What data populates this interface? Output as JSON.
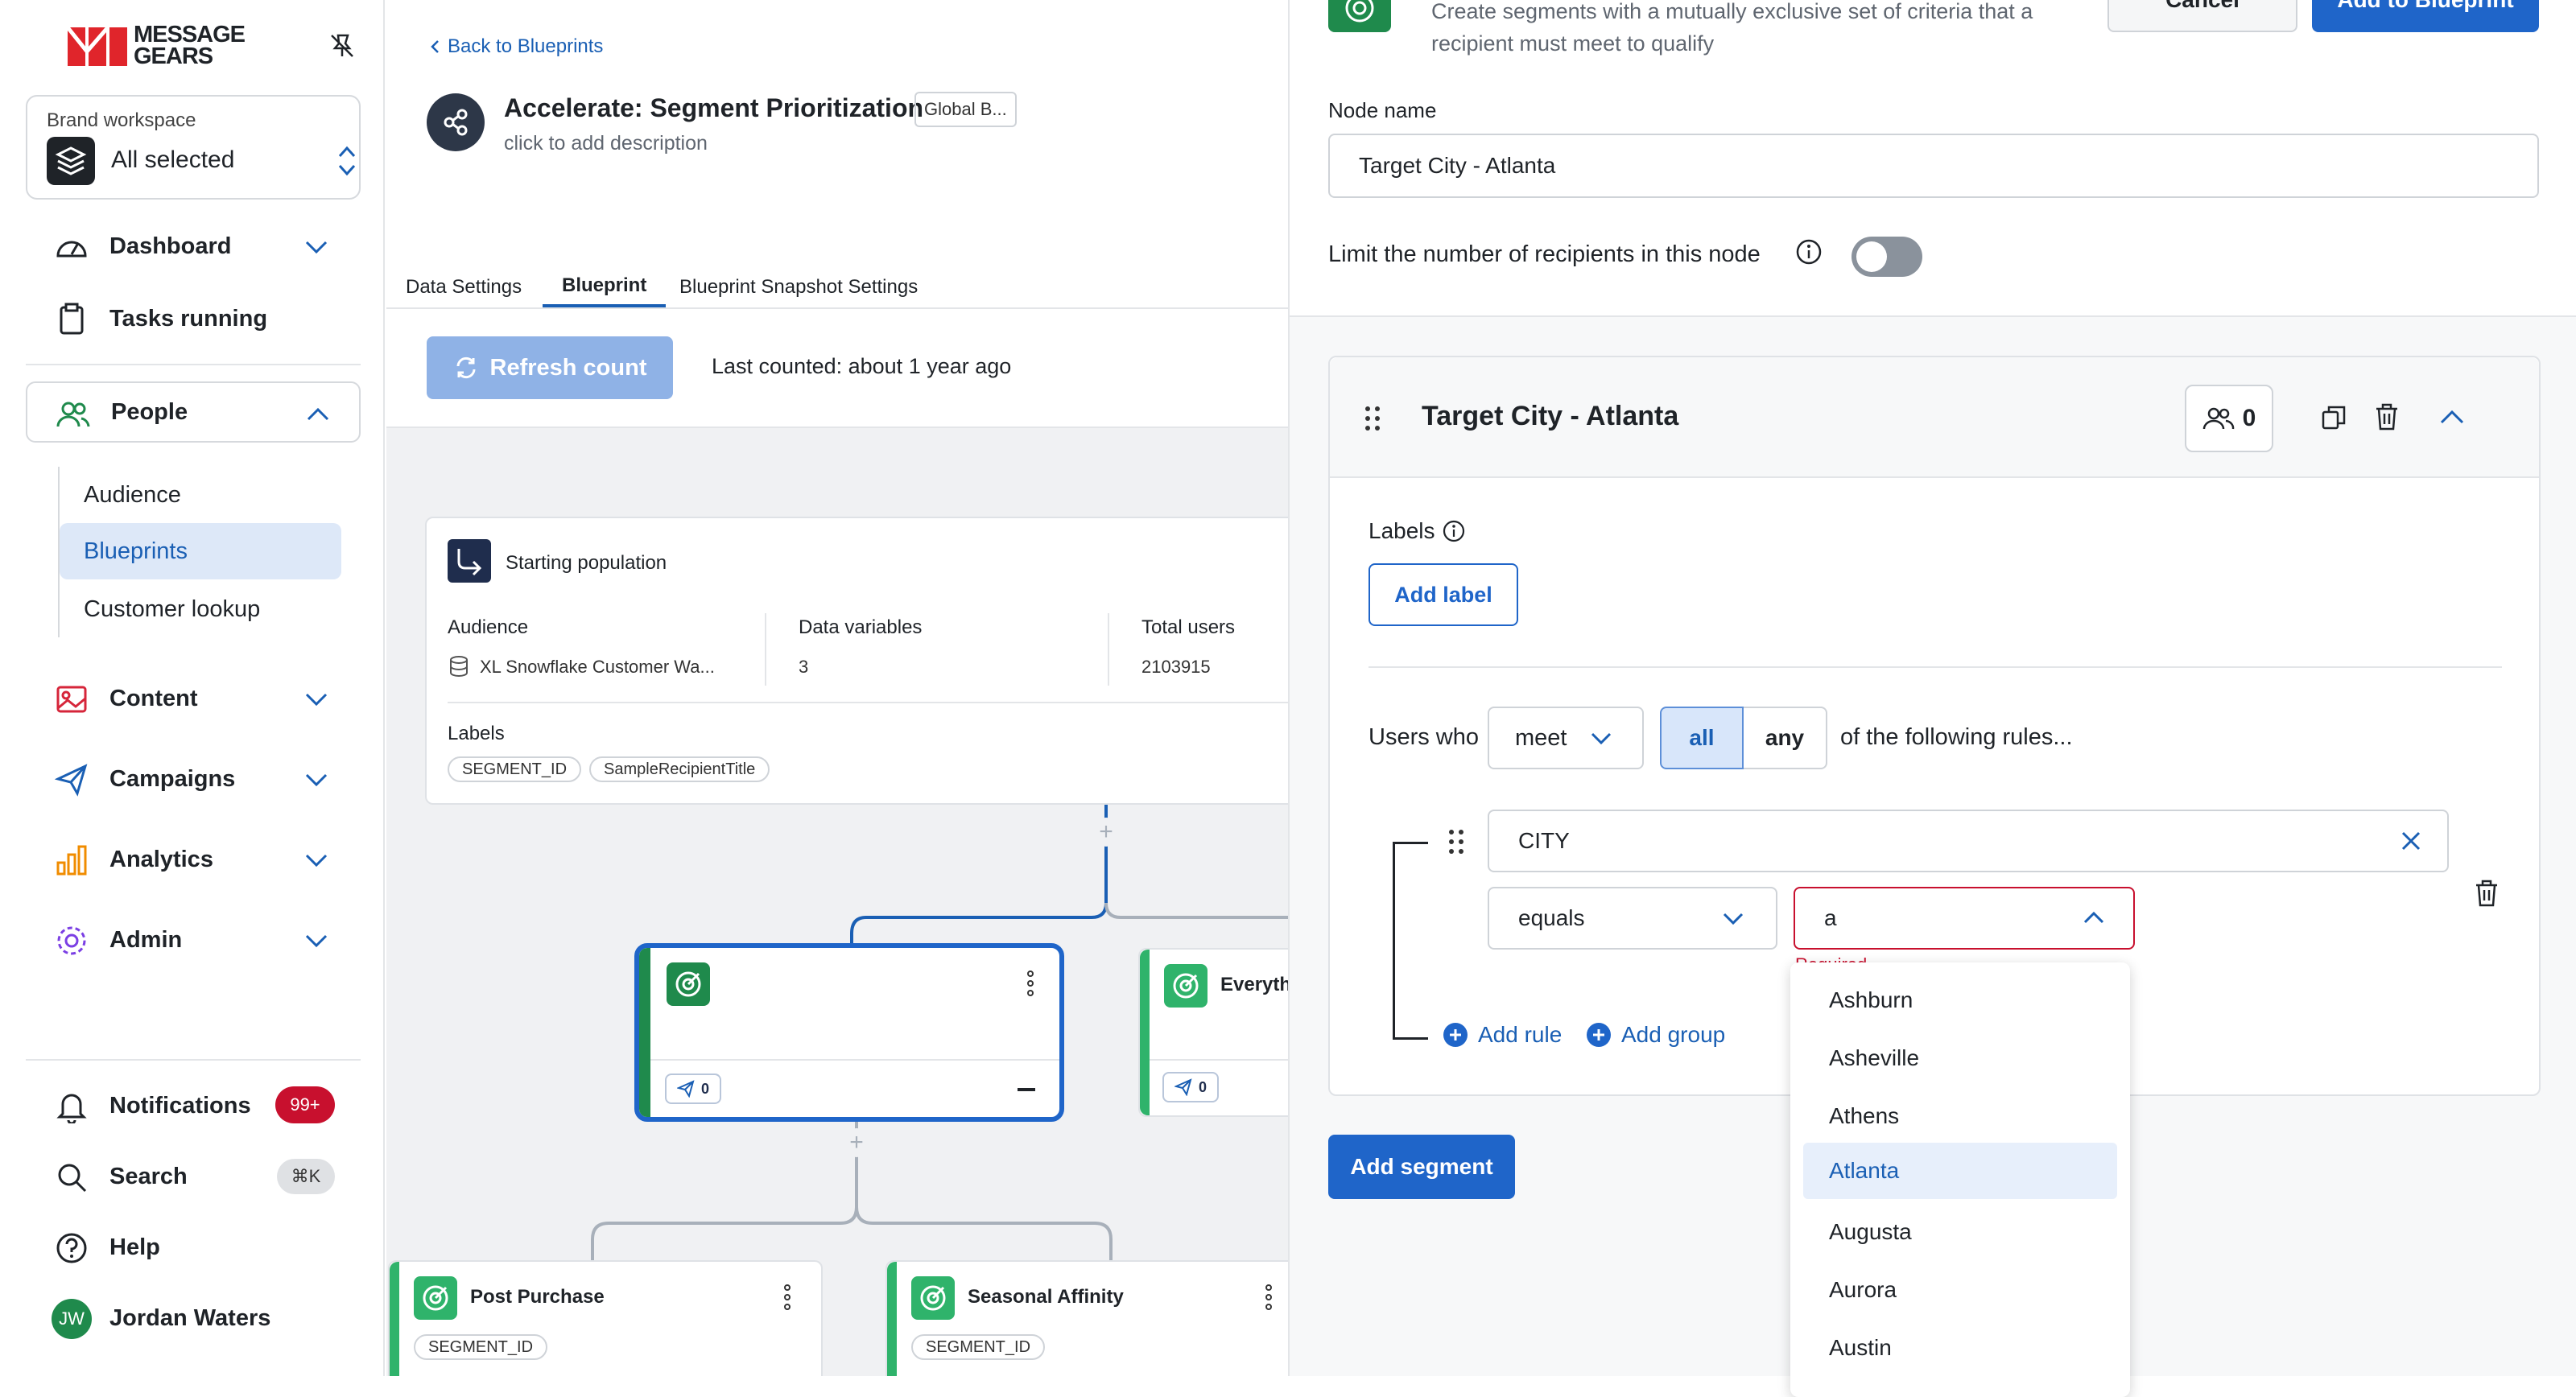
{
  "brand": {
    "logo_text_1": "MESSAGE",
    "logo_text_2": "GEARS",
    "accent": "#e0252b"
  },
  "workspace": {
    "label": "Brand workspace",
    "value": "All selected"
  },
  "nav": {
    "dashboard": "Dashboard",
    "tasks": "Tasks running",
    "people": "People",
    "people_sub": [
      "Audience",
      "Blueprints",
      "Customer lookup"
    ],
    "content": "Content",
    "campaigns": "Campaigns",
    "analytics": "Analytics",
    "admin": "Admin",
    "notifications": "Notifications",
    "notifications_badge": "99+",
    "search": "Search",
    "search_shortcut": "⌘K",
    "help": "Help",
    "user_initials": "JW",
    "user_name": "Jordan Waters"
  },
  "blueprint": {
    "back": "Back to Blueprints",
    "title": "Accelerate: Segment Prioritization",
    "tag": "Global B...",
    "description": "click to add description",
    "tabs": [
      "Data Settings",
      "Blueprint",
      "Blueprint Snapshot Settings"
    ],
    "refresh": "Refresh count",
    "last_counted": "Last counted: about 1 year ago"
  },
  "starting": {
    "title": "Starting population",
    "audience_label": "Audience",
    "audience_value": "XL Snowflake Customer Wa...",
    "datavars_label": "Data variables",
    "datavars_value": "3",
    "total_label": "Total users",
    "total_value": "2103915",
    "labels_label": "Labels",
    "chips": [
      "SEGMENT_ID",
      "SampleRecipientTitle"
    ]
  },
  "nodes": {
    "selected_count": "0",
    "everything_title": "Everyth",
    "everything_count": "0",
    "post_purchase": "Post Purchase",
    "post_chip": "SEGMENT_ID",
    "seasonal": "Seasonal Affinity",
    "seasonal_chip": "SEGMENT_ID"
  },
  "panel": {
    "desc_line1": "Create segments with a mutually exclusive set of criteria that a",
    "desc_line2": "recipient must meet to qualify",
    "cancel": "Cancel",
    "add_to_blueprint": "Add to Blueprint",
    "node_name_label": "Node name",
    "node_name_value": "Target City - Atlanta",
    "limit_label": "Limit the number of recipients in this node",
    "segment_title": "Target City - Atlanta",
    "segment_count": "0",
    "labels_label": "Labels",
    "add_label": "Add label",
    "users_who": "Users who",
    "meet": "meet",
    "all": "all",
    "any": "any",
    "rules_suffix": "of the following rules...",
    "rule_field": "CITY",
    "operator": "equals",
    "value_input": "a",
    "required": "Required",
    "add_rule": "Add rule",
    "add_group": "Add group",
    "add_segment": "Add segment",
    "options": [
      "Ashburn",
      "Asheville",
      "Athens",
      "Atlanta",
      "Augusta",
      "Aurora",
      "Austin"
    ],
    "selected_option": "Atlanta"
  }
}
